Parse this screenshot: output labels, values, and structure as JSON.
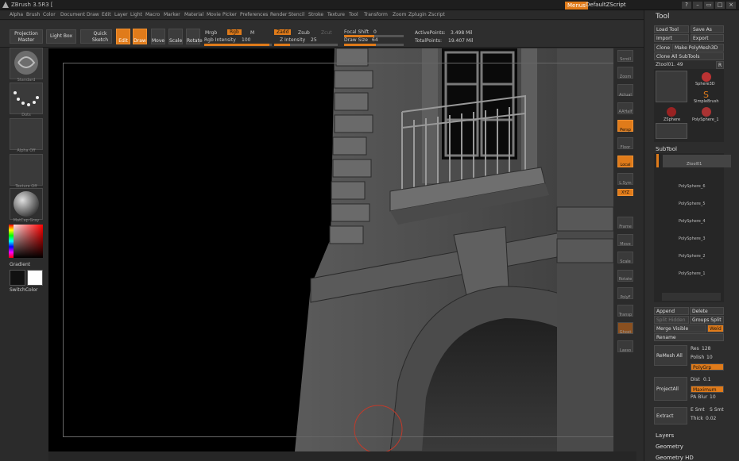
{
  "titlebar": {
    "app_title": "ZBrush 3.5R3 [",
    "menus": "Menus",
    "script": "DefaultZScript"
  },
  "menus": [
    "Alpha",
    "Brush",
    "Color",
    "Document",
    "Draw",
    "Edit",
    "Layer",
    "Light",
    "Macro",
    "Marker",
    "Material",
    "Movie",
    "Picker",
    "Preferences",
    "Render",
    "Stencil",
    "Stroke",
    "Texture",
    "Tool",
    "Transform",
    "Zoom",
    "Zplugin",
    "Zscript"
  ],
  "toolbar": {
    "projection_master": "Projection Master",
    "light_box": "Light Box",
    "quick_sketch": "Quick Sketch",
    "edit": "Edit",
    "draw": "Draw",
    "move": "Move",
    "scale": "Scale",
    "rotate": "Rotate",
    "mrgb": "Mrgb",
    "rgb": "Rgb",
    "m": "M",
    "rgb_intensity_label": "Rgb Intensity",
    "rgb_intensity": "100",
    "zadd": "Zadd",
    "zsub": "Zsub",
    "zcut": "Zcut",
    "z_intensity_label": "Z Intensity",
    "z_intensity": "25",
    "focal_shift_label": "Focal Shift",
    "focal_shift": "0",
    "draw_size_label": "Draw Size",
    "draw_size": "64",
    "active_points_label": "ActivePoints:",
    "active_points": "3.498 Mil",
    "total_points_label": "TotalPoints:",
    "total_points": "19.407 Mil"
  },
  "leftshelf": {
    "brush": "Standard",
    "stroke": "Dots",
    "alpha": "Alpha Off",
    "texture": "Texture Off",
    "material": "MatCap Gray",
    "gradient": "Gradient",
    "switch_color": "SwitchColor"
  },
  "rightshelf": [
    "Scroll",
    "Zoom",
    "Actual",
    "AAHalf",
    "Persp",
    "Floor",
    "Local",
    "L.Sym",
    "XYZ",
    "Frame",
    "Move",
    "Scale",
    "Rotate",
    "PolyF",
    "Transp",
    "Ghost",
    "Lasso"
  ],
  "panel": {
    "title": "Tool",
    "load_tool": "Load Tool",
    "save_as": "Save As",
    "import": "Import",
    "export": "Export",
    "clone": "Clone",
    "make_polymesh": "Make PolyMesh3D",
    "clone_all": "Clone All SubTools",
    "current_tool": "Ztool01. 49",
    "r": "R",
    "tools": [
      "Sphere3D",
      "SimpleBrush",
      "ZSphere",
      "PolySphere_1"
    ],
    "subtool": "SubTool",
    "subtools": [
      "Ztool01",
      "PolySphere_6",
      "PolySphere_5",
      "PolySphere_4",
      "PolySphere_3",
      "PolySphere_2",
      "PolySphere_1"
    ],
    "append": "Append",
    "delete": "Delete",
    "split_hidden": "Split Hidden",
    "groups_split": "Groups Split",
    "merge_visible": "Merge Visible",
    "weld": "Weld",
    "rename": "Rename",
    "remesh_all": "ReMesh All",
    "res_label": "Res",
    "res": "128",
    "polish_label": "Polish",
    "polish": "10",
    "polygrp": "PolyGrp",
    "project_all": "ProjectAll",
    "dist_label": "Dist",
    "dist": "0.1",
    "maximum": "Maximum",
    "pa_blur_label": "PA Blur",
    "pa_blur": "10",
    "extract": "Extract",
    "e_smt": "E Smt",
    "s_smt": "S Smt",
    "thick_label": "Thick",
    "thick": "0.02",
    "layers": "Layers",
    "geometry": "Geometry",
    "geometry_hd": "Geometry HD"
  }
}
